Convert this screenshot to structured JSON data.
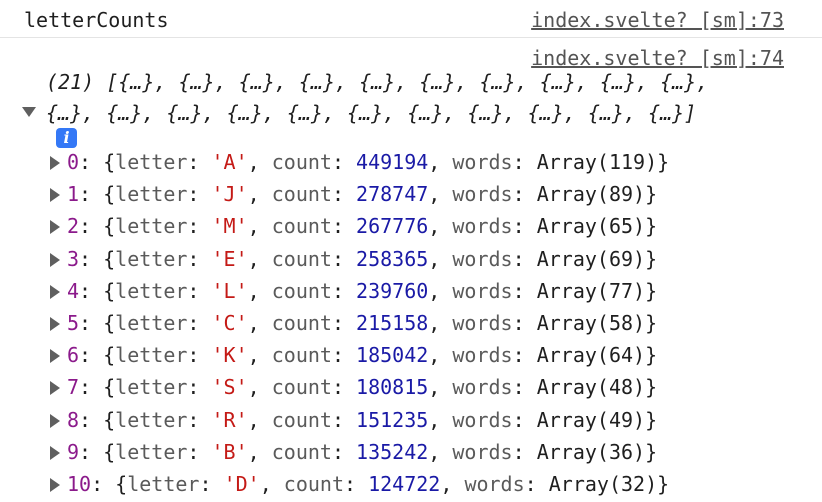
{
  "log": {
    "label": "letterCounts",
    "source1": "index.svelte? [sm]:73",
    "source2": "index.svelte? [sm]:74"
  },
  "array_summary": {
    "line1": "(21) [{…}, {…}, {…}, {…}, {…}, {…}, {…}, {…}, {…}, {…},",
    "line2": "{…}, {…}, {…}, {…}, {…}, {…}, {…}, {…}, {…}, {…}, {…}]"
  },
  "info_icon_label": "i",
  "syntax": {
    "open": "{",
    "letter_key": "letter",
    "count_key": "count",
    "words_key": "words",
    "colon": ": ",
    "comma": ", ",
    "close": "}"
  },
  "entries": [
    {
      "index": "0",
      "letter": "'A'",
      "count": "449194",
      "words": "Array(119)"
    },
    {
      "index": "1",
      "letter": "'J'",
      "count": "278747",
      "words": "Array(89)"
    },
    {
      "index": "2",
      "letter": "'M'",
      "count": "267776",
      "words": "Array(65)"
    },
    {
      "index": "3",
      "letter": "'E'",
      "count": "258365",
      "words": "Array(69)"
    },
    {
      "index": "4",
      "letter": "'L'",
      "count": "239760",
      "words": "Array(77)"
    },
    {
      "index": "5",
      "letter": "'C'",
      "count": "215158",
      "words": "Array(58)"
    },
    {
      "index": "6",
      "letter": "'K'",
      "count": "185042",
      "words": "Array(64)"
    },
    {
      "index": "7",
      "letter": "'S'",
      "count": "180815",
      "words": "Array(48)"
    },
    {
      "index": "8",
      "letter": "'R'",
      "count": "151235",
      "words": "Array(49)"
    },
    {
      "index": "9",
      "letter": "'B'",
      "count": "135242",
      "words": "Array(36)"
    },
    {
      "index": "10",
      "letter": "'D'",
      "count": "124722",
      "words": "Array(32)"
    }
  ],
  "colors": {
    "index": "#8b1a8b",
    "string": "#c41a16",
    "number": "#1a1aa6",
    "key": "#5a5a5a",
    "info_badge": "#3478f6"
  }
}
